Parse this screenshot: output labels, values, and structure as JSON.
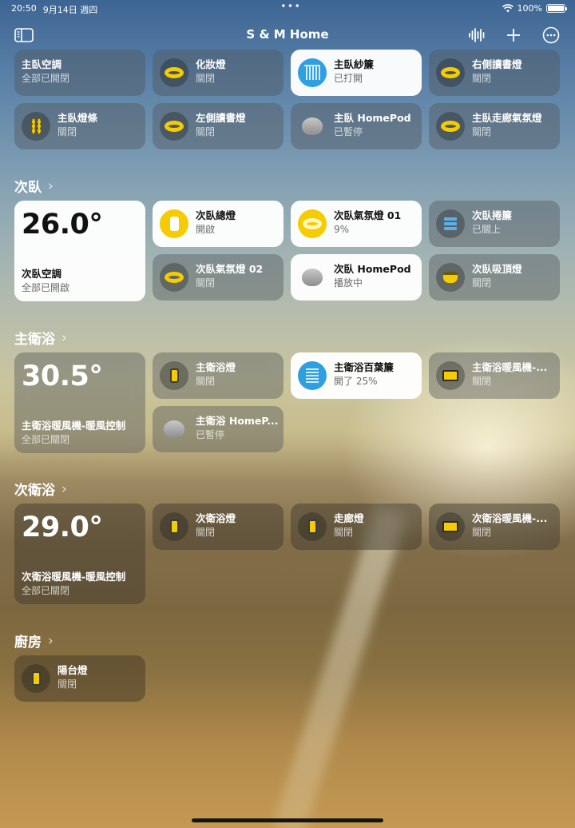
{
  "status_bar": {
    "time": "20:50",
    "date": "9月14日 週四",
    "dots": "•••",
    "battery": "100%"
  },
  "nav": {
    "title": "S & M Home"
  },
  "sections": {
    "second_bedroom": "次臥",
    "master_bath": "主衛浴",
    "second_bath": "次衛浴",
    "kitchen": "廚房"
  },
  "master_bedroom_tiles": [
    {
      "name": "主臥空調",
      "state": "全部已開閉"
    },
    {
      "name": "化妝燈",
      "state": "關閉"
    },
    {
      "name": "主臥紗簾",
      "state": "已打開"
    },
    {
      "name": "右側讀書燈",
      "state": "關閉"
    },
    {
      "name": "主臥燈條",
      "state": "關閉"
    },
    {
      "name": "左側讀書燈",
      "state": "關閉"
    },
    {
      "name": "主臥 HomePod",
      "state": "已暫停"
    },
    {
      "name": "主臥走廊氣氛燈",
      "state": "關閉"
    }
  ],
  "second_bedroom_tiles": [
    {
      "temp": "26.0°",
      "name": "次臥空調",
      "state": "全部已開啟"
    },
    {
      "name": "次臥總燈",
      "state": "開啟"
    },
    {
      "name": "次臥氣氛燈 01",
      "state": "9%"
    },
    {
      "name": "次臥捲簾",
      "state": "已關上"
    },
    {
      "name": "次臥氣氛燈 02",
      "state": "關閉"
    },
    {
      "name": "次臥 HomePod",
      "state": "播放中"
    },
    {
      "name": "次臥吸頂燈",
      "state": "關閉"
    }
  ],
  "master_bath_tiles": [
    {
      "temp": "30.5°",
      "name": "主衛浴暖風機-暖風控制",
      "state": "全部已關閉"
    },
    {
      "name": "主衛浴燈",
      "state": "關閉"
    },
    {
      "name": "主衛浴百葉簾",
      "state": "開了 25%"
    },
    {
      "name": "主衛浴暖風機-...",
      "state": "關閉"
    },
    {
      "name": "主衛浴 HomeP...",
      "state": "已暫停"
    }
  ],
  "second_bath_tiles": [
    {
      "temp": "29.0°",
      "name": "次衛浴暖風機-暖風控制",
      "state": "全部已關閉"
    },
    {
      "name": "次衛浴燈",
      "state": "關閉"
    },
    {
      "name": "走廊燈",
      "state": "關閉"
    },
    {
      "name": "次衛浴暖風機-...",
      "state": "關閉"
    }
  ],
  "kitchen_tiles": [
    {
      "name": "陽台燈",
      "state": "關閉"
    }
  ]
}
